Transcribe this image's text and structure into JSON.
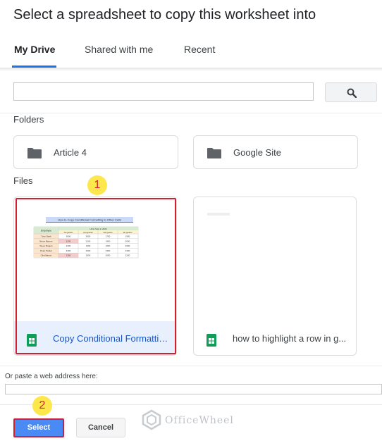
{
  "dialog": {
    "title": "Select a spreadsheet to copy this worksheet into"
  },
  "tabs": [
    {
      "label": "My Drive",
      "active": true
    },
    {
      "label": "Shared with me",
      "active": false
    },
    {
      "label": "Recent",
      "active": false
    }
  ],
  "search": {
    "value": "",
    "button_icon": "search-icon"
  },
  "folders": {
    "label": "Folders",
    "items": [
      {
        "name": "Article 4",
        "icon": "folder-icon"
      },
      {
        "name": "Google Site",
        "icon": "folder-icon"
      }
    ]
  },
  "files": {
    "label": "Files",
    "items": [
      {
        "name": "Copy Conditional Formattin...",
        "icon": "google-sheets-icon",
        "selected": true
      },
      {
        "name": "how to highlight a row in g...",
        "icon": "google-sheets-icon",
        "selected": false
      }
    ]
  },
  "thumbnail": {
    "title": "How to Copy Conditional Formatting to Other Cells",
    "group_header": "Units Sold in 2022",
    "employee_header": "Employee",
    "quarters": [
      "1st Quarter",
      "2nd Quarter",
      "3rd Quarter",
      "4th Quarter"
    ],
    "rows": [
      {
        "name": "Tony Stark",
        "values": [
          "3000",
          "3600",
          "1700",
          "1900"
        ]
      },
      {
        "name": "Bruce Banner",
        "values": [
          "1200",
          "2100",
          "1900",
          "2000"
        ]
      },
      {
        "name": "Steve Rogers",
        "values": [
          "2400",
          "1300",
          "1600",
          "2000"
        ]
      },
      {
        "name": "Peter Parker",
        "values": [
          "3400",
          "2300",
          "2300",
          "2300"
        ]
      },
      {
        "name": "Clint Barton",
        "values": [
          "1300",
          "1600",
          "2000",
          "2200"
        ]
      }
    ]
  },
  "paste": {
    "label": "Or paste a web address here:",
    "value": ""
  },
  "buttons": {
    "select": "Select",
    "cancel": "Cancel"
  },
  "annotations": {
    "step1": "1",
    "step2": "2"
  },
  "watermark": {
    "text": "OfficeWheel"
  },
  "colors": {
    "accent": "#1a73e8",
    "select_button": "#4a8af4",
    "highlight": "#d2202f",
    "badge": "#fde74c",
    "sheets_green": "#0f9d58"
  }
}
